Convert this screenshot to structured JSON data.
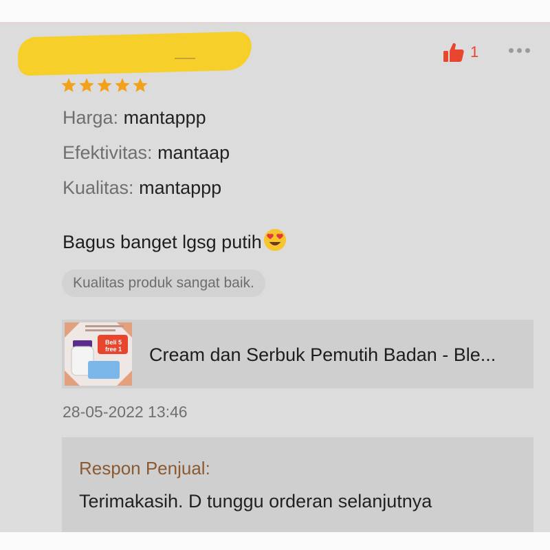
{
  "review": {
    "rating": 5,
    "max_rating": 5,
    "like_count": "1",
    "attributes": [
      {
        "key": "Harga:",
        "value": "mantappp"
      },
      {
        "key": "Efektivitas:",
        "value": "mantaap"
      },
      {
        "key": "Kualitas:",
        "value": "mantappp"
      }
    ],
    "text": "Bagus banget lgsg putih",
    "emoji": "😍",
    "tag": "Kualitas produk sangat baik.",
    "date": "28-05-2022 13:46"
  },
  "product": {
    "title": "Cream dan Serbuk Pemutih Badan - Ble...",
    "thumb_badge": "Beli 5 free 1"
  },
  "seller_response": {
    "label": "Respon Penjual:",
    "text": "Terimakasih. D tunggu orderan selanjutnya"
  },
  "colors": {
    "star": "#f2a11a",
    "like": "#e8452e",
    "redaction": "#f7cf2a",
    "seller_label": "#8a5a32"
  },
  "icons": [
    "thumbs-up-icon",
    "more-options-icon",
    "star-icon",
    "heart-eyes-emoji"
  ]
}
